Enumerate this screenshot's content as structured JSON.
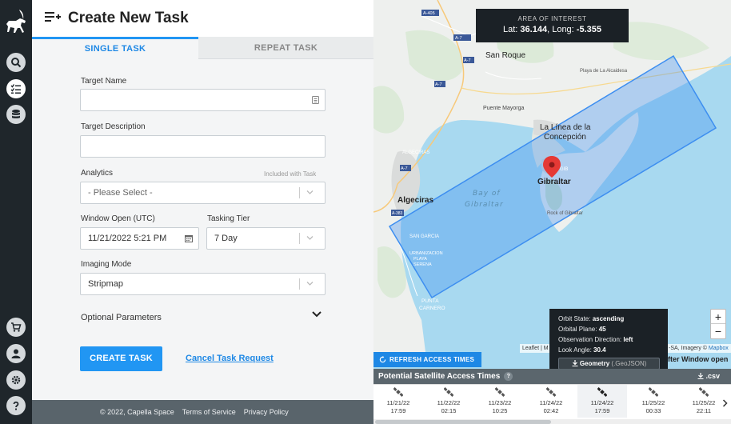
{
  "header": {
    "title": "Create New Task"
  },
  "tabs": [
    {
      "label": "SINGLE TASK"
    },
    {
      "label": "REPEAT TASK"
    }
  ],
  "form": {
    "target_name_label": "Target Name",
    "target_name_value": "",
    "target_desc_label": "Target Description",
    "target_desc_value": "",
    "analytics_label": "Analytics",
    "analytics_hint": "Included with Task",
    "analytics_value": "- Please Select -",
    "window_open_label": "Window Open (UTC)",
    "window_open_value": "11/21/2022 5:21 PM",
    "tasking_tier_label": "Tasking Tier",
    "tasking_tier_value": "7 Day",
    "imaging_mode_label": "Imaging Mode",
    "imaging_mode_value": "Stripmap",
    "optional_label": "Optional Parameters",
    "create_label": "CREATE TASK",
    "cancel_label": "Cancel Task Request"
  },
  "footer": {
    "copyright": "© 2022, Capella Space",
    "terms": "Terms of Service",
    "privacy": "Privacy Policy"
  },
  "map": {
    "aoi_title": "AREA OF INTEREST",
    "lat_label": "Lat:",
    "lat_value": "36.144",
    "long_label": "Long:",
    "long_value": "-5.355",
    "places": {
      "san_roque": "San Roque",
      "la_linea": "La Línea de la",
      "concepcion": "Concepción",
      "gibraltar": "Gibraltar",
      "algeciras": "Algeciras",
      "bay1": "Bay of",
      "bay2": "Gibraltar",
      "puente": "Puente Mayorga",
      "playa": "Playa de La Alcaidesa",
      "san_garcia": "SAN GARCIA",
      "urb1": "URBANIZACION",
      "urb2": "PLAYA",
      "urb3": "SERENA",
      "punta1": "PUNTA",
      "punta2": "CARNERO",
      "rock": "Rock of Gibraltar",
      "gib_code": "GIB",
      "algeciras_small": "ALGECIRAS",
      "r_a405": "A-405",
      "r_a7_1": "A-7",
      "r_a7_2": "A-7",
      "r_a7_3": "A-7",
      "r_a7_4": "A-7",
      "r_a383": "A-383"
    },
    "zoom_in": "+",
    "zoom_out": "−",
    "attribution_left": "Leaflet | M",
    "attribution_right_pre": "-SA, Imagery © ",
    "attribution_right_link": "Mapbox",
    "colors": {
      "footprint": "#3d8ef0",
      "water": "#a8d9f0",
      "land": "#eef0ee"
    }
  },
  "tooltip": {
    "orbit_state_label": "Orbit State:",
    "orbit_state_value": "ascending",
    "orbital_plane_label": "Orbital Plane:",
    "orbital_plane_value": "45",
    "obs_dir_label": "Observation Direction:",
    "obs_dir_value": "left",
    "look_angle_label": "Look Angle:",
    "look_angle_value": "30.4",
    "geometry_label": "Geometry",
    "geometry_suffix": "(.GeoJSON)"
  },
  "access": {
    "refresh_label": "REFRESH ACCESS TIMES",
    "after_window": "fter Window open",
    "title": "Potential Satellite Access Times",
    "help": "?",
    "csv_label": ".csv",
    "times": [
      {
        "date": "11/21/22",
        "time": "17:59"
      },
      {
        "date": "11/22/22",
        "time": "02:15"
      },
      {
        "date": "11/23/22",
        "time": "10:25"
      },
      {
        "date": "11/24/22",
        "time": "02:42"
      },
      {
        "date": "11/24/22",
        "time": "17:59"
      },
      {
        "date": "11/25/22",
        "time": "00:33"
      },
      {
        "date": "11/25/22",
        "time": "22:11"
      }
    ]
  }
}
